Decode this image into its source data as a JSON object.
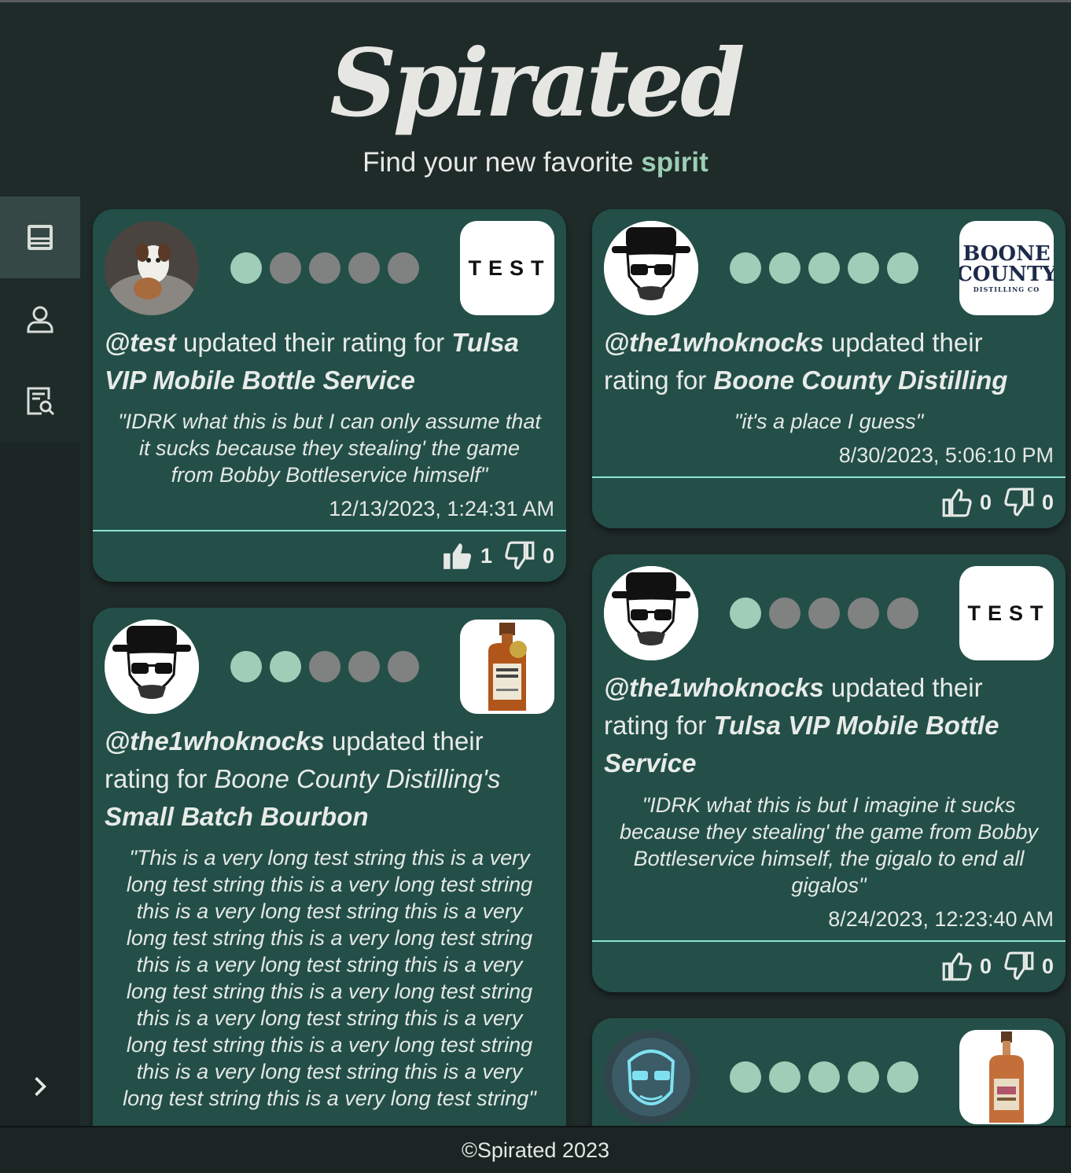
{
  "header": {
    "logo": "Spirated",
    "tagline_prefix": "Find your new favorite ",
    "tagline_accent": "spirit"
  },
  "sidebar": {
    "items": [
      {
        "icon": "feed-icon",
        "active": true
      },
      {
        "icon": "user-icon",
        "active": false
      },
      {
        "icon": "search-list-icon",
        "active": false
      }
    ],
    "expand_icon": "chevron-right-icon"
  },
  "colors": {
    "background": "#1f2b29",
    "card": "#234f48",
    "dot_on": "#9fcdb7",
    "dot_off": "#7f8281",
    "accent": "#9ccdb5",
    "divider": "#8fe3d2"
  },
  "feed": [
    {
      "user": "@test",
      "action": " updated their rating for ",
      "spirit": "Tulsa VIP Mobile Bottle Service",
      "rating": 1,
      "review": "\"IDRK what this is but I can only assume that it sucks because they stealing' the game from Bobby Bottleservice himself\"",
      "date": "12/13/2023, 1:24:31 AM",
      "likes": "1",
      "dislikes": "0",
      "liked": true,
      "thumb": "TEST"
    },
    {
      "user": "@the1whoknocks",
      "action": " updated their rating for ",
      "brand": "Boone County Distilling's",
      "spirit": "Small Batch Bourbon",
      "rating": 2,
      "review": "\"This is a very long test string this is a very long test string this is a very long test string this is a very long test string this is a very long test string this is a very long test string this is a very long test string this is a very long test string this is a very long test string this is a very long test string this is a very long test string this is a very long test string this is a very long test string this is a very long test string this is a very long test string\""
    },
    {
      "user": "@the1whoknocks",
      "action": " updated their rating for ",
      "spirit": "Boone County Distilling",
      "rating": 5,
      "review": "\"it's a place I guess\"",
      "date": "8/30/2023, 5:06:10 PM",
      "likes": "0",
      "dislikes": "0",
      "liked": false,
      "thumb_line1": "BOONE",
      "thumb_line2": "COUNTY",
      "thumb_line3": "DISTILLING CO"
    },
    {
      "user": "@the1whoknocks",
      "action": " updated their rating for ",
      "spirit": "Tulsa VIP Mobile Bottle Service",
      "rating": 1,
      "review": "\"IDRK what this is but I imagine it sucks because they stealing' the game from Bobby Bottleservice himself, the gigalo to end all gigalos\"",
      "date": "8/24/2023, 12:23:40 AM",
      "likes": "0",
      "dislikes": "0",
      "liked": false,
      "thumb": "TEST"
    },
    {
      "rating": 5
    }
  ],
  "footer": {
    "text": "©Spirated 2023"
  }
}
